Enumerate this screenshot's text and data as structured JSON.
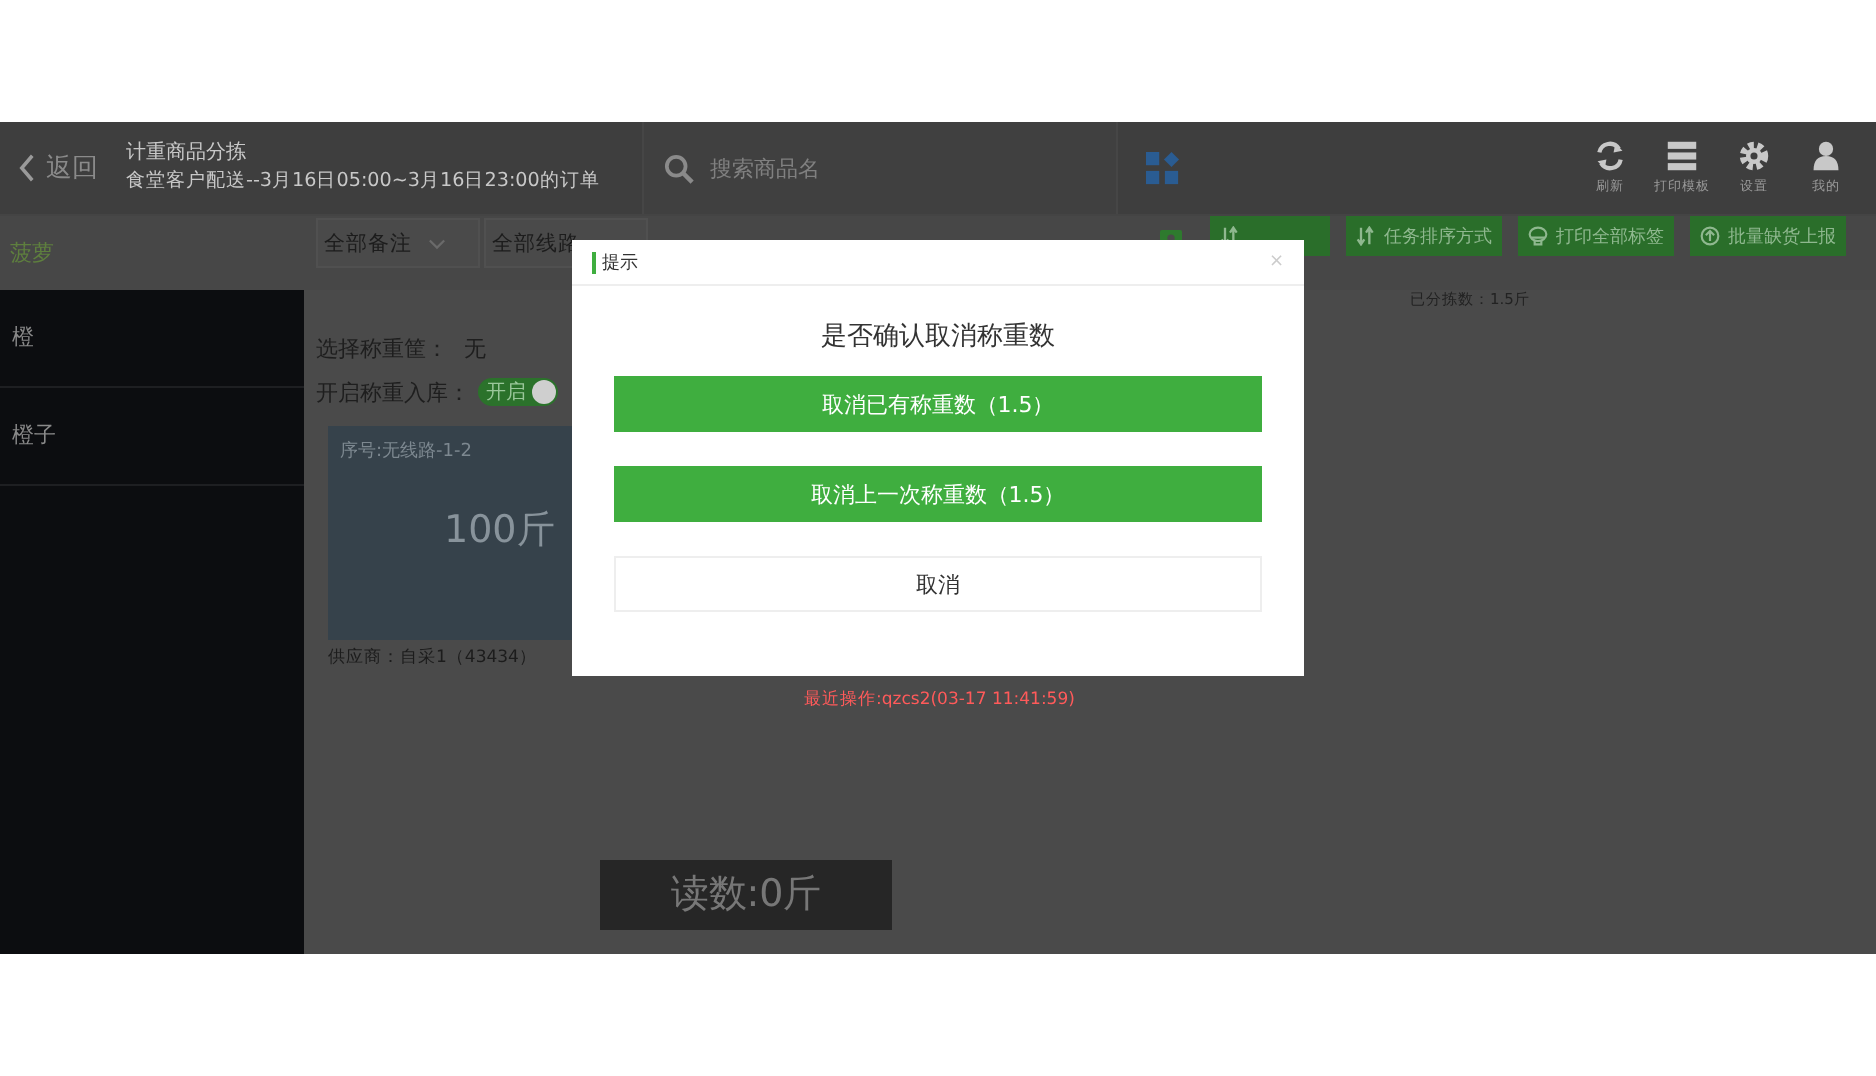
{
  "header": {
    "back": "返回",
    "title": "计重商品分拣",
    "subtitle": "食堂客户配送--3月16日05:00~3月16日23:00的订单",
    "search": {
      "placeholder": "搜索商品名"
    },
    "tools": [
      {
        "kind": "refresh",
        "label": "刷新"
      },
      {
        "kind": "print",
        "label": "打印模板"
      },
      {
        "kind": "settings",
        "label": "设置"
      },
      {
        "kind": "user",
        "label": "我的"
      }
    ]
  },
  "toolbar": {
    "category": "菠萝",
    "filters": [
      {
        "label": "全部备注",
        "caret": true
      },
      {
        "label": "全部线路"
      }
    ],
    "actions": [
      {
        "kind": "photo"
      },
      {
        "kind": "sort",
        "label": "任务排序方式"
      },
      {
        "kind": "print",
        "label": "打印全部标签"
      },
      {
        "kind": "report",
        "label": "批量缺货上报"
      }
    ],
    "sorted_count": "已分拣数：1.5斤"
  },
  "sidebar": {
    "items": [
      {
        "label": "橙",
        "selected": false
      },
      {
        "label": "橙子",
        "selected": false
      }
    ]
  },
  "main": {
    "basket_label": "选择称重筐：",
    "basket_value": "无",
    "stock_label": "开启称重入库：",
    "stock_toggle": {
      "label": "开启",
      "on": true
    },
    "cards": [
      {
        "serial": "序号:无线路-1-2",
        "weight": "100斤",
        "supplier": "供应商：自采1（43434）"
      },
      {
        "last_action": "最近操作:qzcs2(03-17 11:41:59)"
      }
    ],
    "reading": "读数:0斤"
  },
  "dialog": {
    "title": "提示",
    "close": "×",
    "message": "是否确认取消称重数",
    "buttons": [
      {
        "kind": "primary",
        "label": "取消已有称重数（1.5）"
      },
      {
        "kind": "primary",
        "label": "取消上一次称重数（1.5）"
      },
      {
        "kind": "plain",
        "label": "取消"
      }
    ]
  }
}
